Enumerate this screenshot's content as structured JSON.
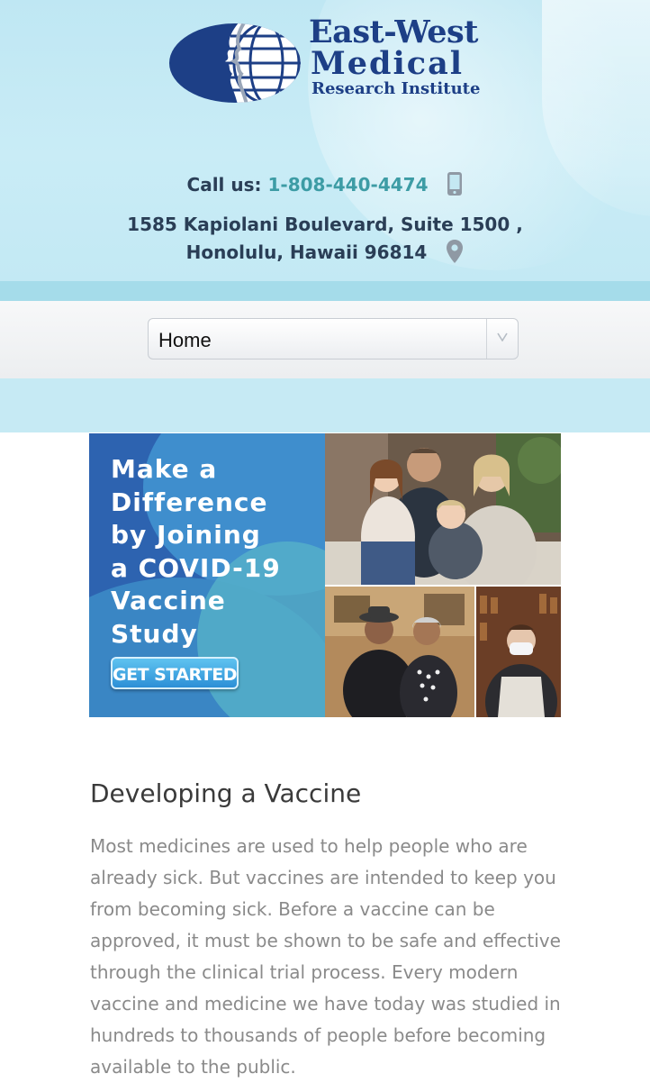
{
  "header": {
    "logo_line1": "East-West",
    "logo_line2": "Medical",
    "logo_line3": "Research Institute",
    "call_label": "Call us:",
    "phone": "1-808-440-4474",
    "address_line1": "1585 Kapiolani Boulevard, Suite 1500 ,",
    "address_line2": "Honolulu, Hawaii 96814",
    "colors": {
      "brand": "#1d3f86",
      "phone": "#3d9ca5",
      "header_bg": "#c6eaf4"
    }
  },
  "nav": {
    "selected": "Home"
  },
  "banner": {
    "headline": "Make a\nDifference\nby Joining\na COVID-19\nVaccine\nStudy",
    "cta_label": "GET STARTED"
  },
  "article": {
    "title": "Developing a Vaccine",
    "body": "Most medicines are used to help people who are already sick. But vaccines are intended to keep you from becoming sick. Before a vaccine can be approved, it must be shown to be safe and effective through the clinical trial process. Every modern vaccine and medicine we have today was studied in hundreds to thousands of people before becoming available to the public."
  },
  "icons": [
    "phone-icon",
    "map-pin-icon",
    "chevron-down-icon",
    "globe-profile-logo-icon"
  ]
}
